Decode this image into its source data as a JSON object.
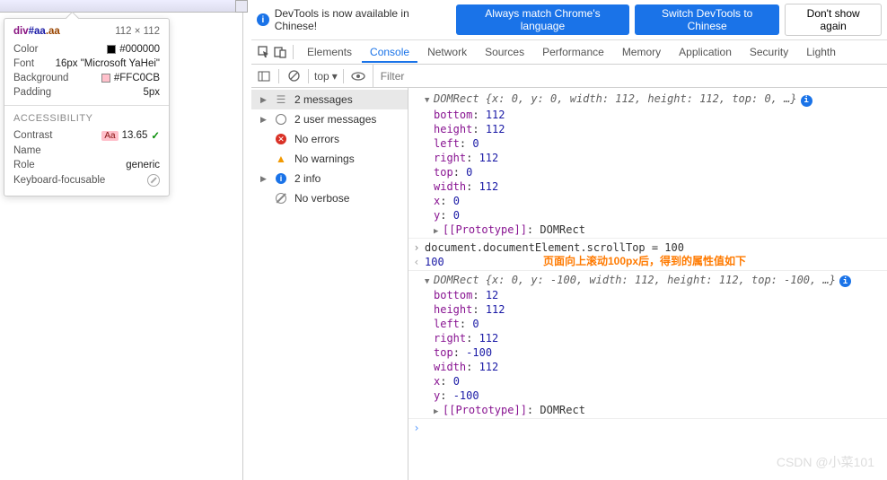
{
  "tooltip": {
    "selector_tag": "div",
    "selector_id": "#aa",
    "selector_cls": ".aa",
    "dimensions": "112 × 112",
    "color_label": "Color",
    "color_value": "#000000",
    "font_label": "Font",
    "font_value": "16px \"Microsoft YaHei\"",
    "bg_label": "Background",
    "bg_value": "#FFC0CB",
    "padding_label": "Padding",
    "padding_value": "5px",
    "a11y_title": "ACCESSIBILITY",
    "contrast_label": "Contrast",
    "contrast_badge": "Aa",
    "contrast_value": "13.65",
    "name_label": "Name",
    "role_label": "Role",
    "role_value": "generic",
    "kbd_label": "Keyboard-focusable"
  },
  "banner": {
    "text": "DevTools is now available in Chinese!",
    "btn1": "Always match Chrome's language",
    "btn2": "Switch DevTools to Chinese",
    "btn3": "Don't show again"
  },
  "tabs": {
    "elements": "Elements",
    "console": "Console",
    "network": "Network",
    "sources": "Sources",
    "performance": "Performance",
    "memory": "Memory",
    "application": "Application",
    "security": "Security",
    "lighthouse": "Lighth"
  },
  "toolbar": {
    "context": "top",
    "filter_placeholder": "Filter"
  },
  "sidebar": {
    "messages": "2 messages",
    "user": "2 user messages",
    "errors": "No errors",
    "warnings": "No warnings",
    "info": "2 info",
    "verbose": "No verbose"
  },
  "log": {
    "rect1_summary": "DOMRect {x: 0, y: 0, width: 112, height: 112, top: 0, …}",
    "rect1": {
      "bottom": "112",
      "height": "112",
      "left": "0",
      "right": "112",
      "top": "0",
      "width": "112",
      "x": "0",
      "y": "0"
    },
    "proto": "[[Prototype]]",
    "proto_val": "DOMRect",
    "cmd": "document.documentElement.scrollTop = 100",
    "cmd_result": "100",
    "annotation": "页面向上滚动100px后，得到的属性值如下",
    "rect2_summary": "DOMRect {x: 0, y: -100, width: 112, height: 112, top: -100, …}",
    "rect2": {
      "bottom": "12",
      "height": "112",
      "left": "0",
      "right": "112",
      "top": "-100",
      "width": "112",
      "x": "0",
      "y": "-100"
    }
  },
  "watermark": "CSDN @小菜101"
}
